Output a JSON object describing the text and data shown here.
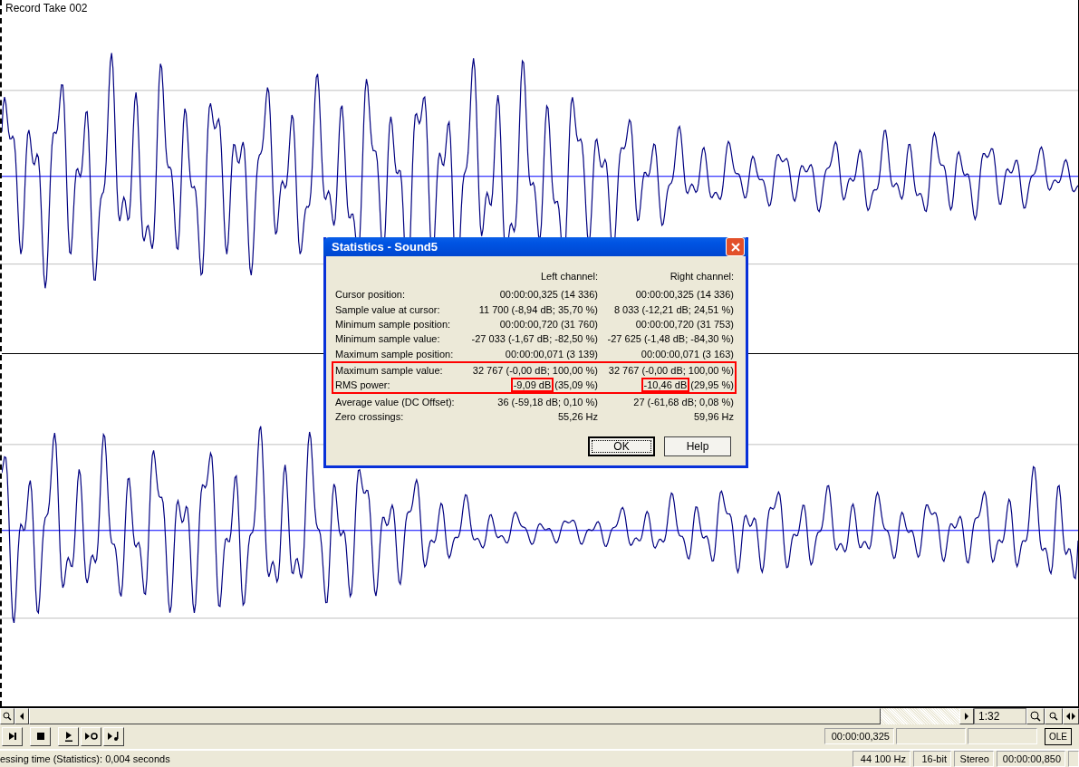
{
  "track_label": "Record Take 002",
  "dialog": {
    "title": "Statistics - Sound5",
    "columns": [
      "Left channel:",
      "Right channel:"
    ],
    "rows": [
      {
        "label": "Cursor position:",
        "highlighted": false,
        "cells": [
          {
            "text": "00:00:00,325  (14 336)"
          },
          {
            "text": "00:00:00,325  (14 336)"
          }
        ]
      },
      {
        "label": "Sample value at cursor:",
        "highlighted": false,
        "cells": [
          {
            "text": "11 700 (-8,94 dB; 35,70 %)"
          },
          {
            "text": "8 033 (-12,21 dB; 24,51 %)"
          }
        ]
      },
      {
        "label": "Minimum sample position:",
        "highlighted": false,
        "cells": [
          {
            "text": "00:00:00,720  (31 760)"
          },
          {
            "text": "00:00:00,720  (31 753)"
          }
        ]
      },
      {
        "label": "Minimum sample value:",
        "highlighted": false,
        "cells": [
          {
            "text": "-27 033 (-1,67 dB; -82,50 %)"
          },
          {
            "text": "-27 625 (-1,48 dB; -84,30 %)"
          }
        ]
      },
      {
        "label": "Maximum sample position:",
        "highlighted": false,
        "cells": [
          {
            "text": "00:00:00,071  (3 139)"
          },
          {
            "text": "00:00:00,071  (3 163)"
          }
        ]
      },
      {
        "label": "Maximum sample value:",
        "highlighted": true,
        "cells": [
          {
            "text": "32 767 (-0,00 dB; 100,00 %)"
          },
          {
            "text": "32 767 (-0,00 dB; 100,00 %)"
          }
        ]
      },
      {
        "label": "RMS power:",
        "highlighted": true,
        "cells": [
          {
            "boxed": "-9,09 dB",
            "text": "(35,09 %)"
          },
          {
            "boxed": "-10,46 dB",
            "text": "(29,95 %)"
          }
        ]
      },
      {
        "label": "Average value (DC Offset):",
        "highlighted": false,
        "cells": [
          {
            "text": "36 (-59,18 dB; 0,10 %)"
          },
          {
            "text": "27 (-61,68 dB; 0,08 %)"
          }
        ]
      },
      {
        "label": "Zero crossings:",
        "highlighted": false,
        "cells": [
          {
            "text": "55,26 Hz"
          },
          {
            "text": "59,96 Hz"
          }
        ]
      }
    ],
    "buttons": [
      {
        "label": "OK",
        "default": true
      },
      {
        "label": "Help",
        "default": false
      }
    ]
  },
  "zoom_field": {
    "value": "1:32"
  },
  "position_field": {
    "value": "00:00:00,325"
  },
  "ole_button": {
    "label": "OLE"
  },
  "status_bar": {
    "message": "essing time (Statistics): 0,004 seconds",
    "fields": [
      "44 100 Hz",
      "16-bit",
      "Stereo",
      "00:00:00,850"
    ]
  }
}
